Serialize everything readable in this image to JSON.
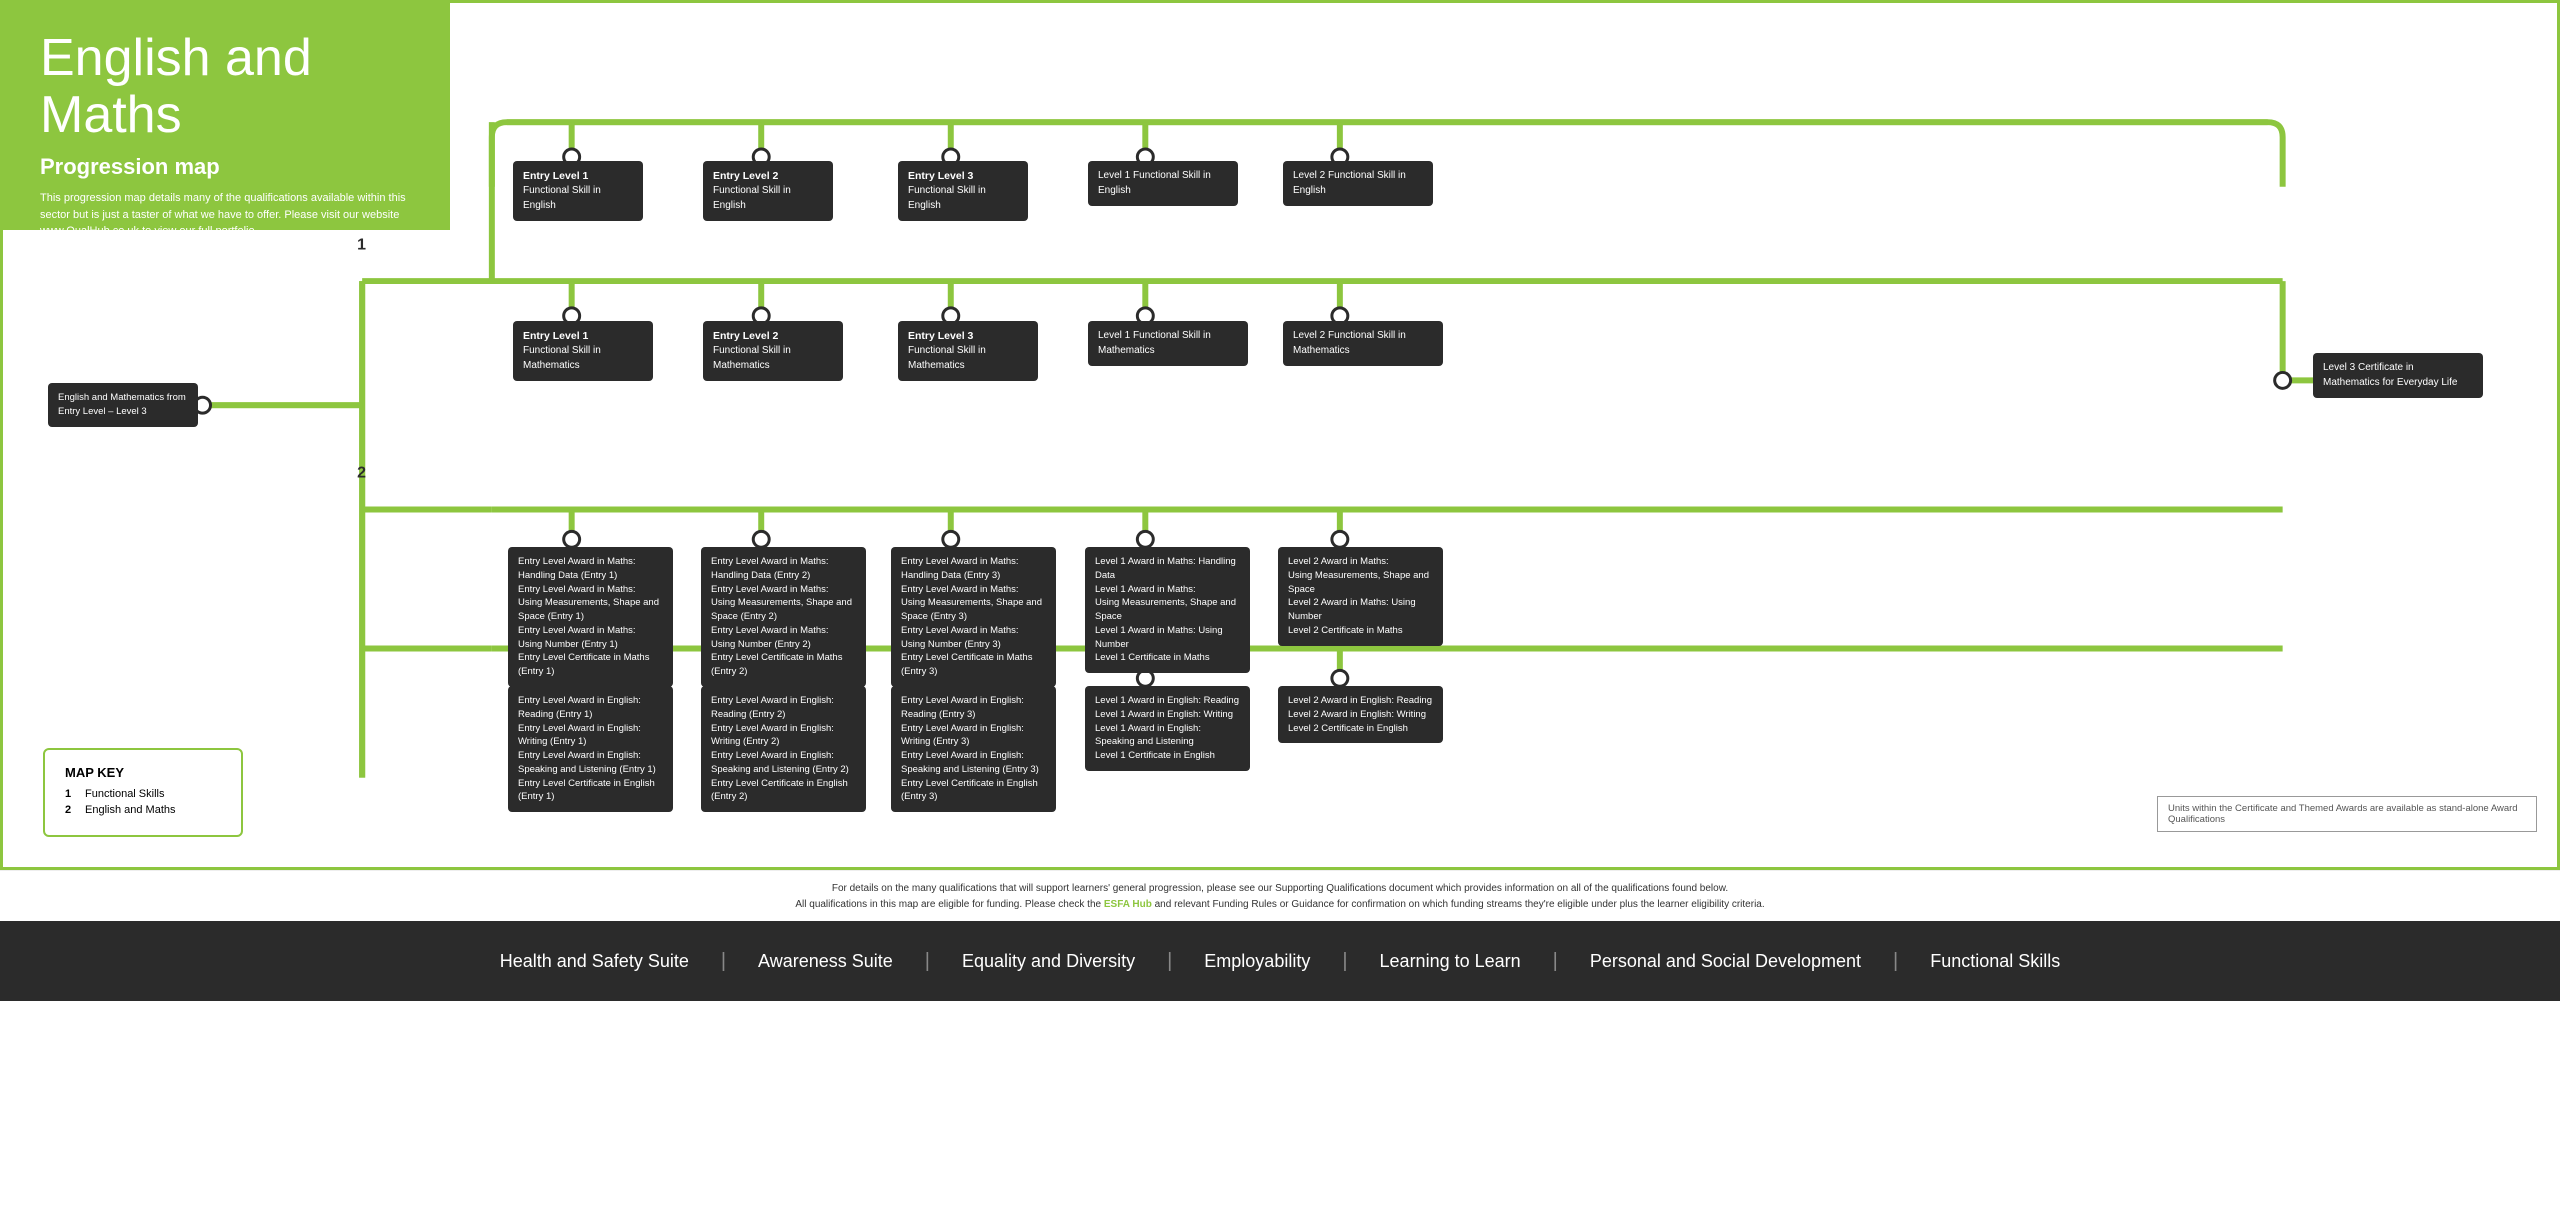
{
  "header": {
    "title": "English and Maths",
    "subtitle": "Progression map",
    "description": "This progression map details many of the qualifications available within this sector but is just a taster of what we have to offer. Please visit our website ",
    "website": "www.QualHub.co.uk",
    "website_suffix": " to view our full portfolio."
  },
  "mapkey": {
    "title": "MAP KEY",
    "items": [
      {
        "num": "1",
        "label": "Functional Skills"
      },
      {
        "num": "2",
        "label": "English and Maths"
      }
    ]
  },
  "tracks": {
    "line1_label": "1",
    "line2_label": "2"
  },
  "qualifications": {
    "start_box": {
      "title": "English and Mathematics from Entry Level – Level 3"
    },
    "row1": [
      {
        "title": "Entry Level 1",
        "sub": "Functional Skill in English"
      },
      {
        "title": "Entry Level 2",
        "sub": "Functional Skill in English"
      },
      {
        "title": "Entry Level 3",
        "sub": "Functional Skill in English"
      },
      {
        "title": "Level 1 Functional Skill in English",
        "sub": ""
      },
      {
        "title": "Level 2 Functional Skill in English",
        "sub": ""
      }
    ],
    "row2": [
      {
        "title": "Entry Level 1",
        "sub": "Functional Skill in Mathematics"
      },
      {
        "title": "Entry Level 2",
        "sub": "Functional Skill in Mathematics"
      },
      {
        "title": "Entry Level 3",
        "sub": "Functional Skill in Mathematics"
      },
      {
        "title": "Level 1 Functional Skill in Mathematics",
        "sub": ""
      },
      {
        "title": "Level 2 Functional Skill in Mathematics",
        "sub": ""
      }
    ],
    "row3": [
      {
        "lines": [
          "Entry Level Award in Maths:",
          "Handling Data (Entry 1)",
          "Entry Level Award in Maths:",
          "Using Measurements, Shape and Space (Entry 1)",
          "Entry Level Award in Maths:",
          "Using Number (Entry 1)",
          "Entry Level Certificate in Maths (Entry 1)"
        ]
      },
      {
        "lines": [
          "Entry Level Award in Maths:",
          "Handling Data (Entry 2)",
          "Entry Level Award in Maths:",
          "Using Measurements, Shape and Space (Entry 2)",
          "Entry Level Award in Maths:",
          "Using Number (Entry 2)",
          "Entry Level Certificate in Maths (Entry 2)"
        ]
      },
      {
        "lines": [
          "Entry Level Award in Maths:",
          "Handling Data (Entry 3)",
          "Entry Level Award in Maths:",
          "Using Measurements, Shape and Space (Entry 3)",
          "Entry Level Award in Maths:",
          "Using Number (Entry 3)",
          "Entry Level Certificate in Maths (Entry 3)"
        ]
      },
      {
        "lines": [
          "Level 1 Award in Maths: Handling Data",
          "Level 1 Award in Maths:",
          "Using Measurements, Shape and Space",
          "Level 1 Award in Maths: Using Number",
          "Level 1 Certificate in Maths"
        ]
      },
      {
        "lines": [
          "Level 2 Award in Maths:",
          "Using Measurements, Shape and Space",
          "Level 2 Award in Maths: Using Number",
          "Level 2 Certificate in Maths"
        ]
      }
    ],
    "row4": [
      {
        "lines": [
          "Entry Level Award in English: Reading (Entry 1)",
          "Entry Level Award in English: Writing (Entry 1)",
          "Entry Level Award in English: Speaking and",
          "Listening (Entry 1)",
          "Entry Level Certificate in English (Entry 1)"
        ]
      },
      {
        "lines": [
          "Entry Level Award in English: Reading (Entry 2)",
          "Entry Level Award in English: Writing (Entry 2)",
          "Entry Level Award in English: Speaking and",
          "Listening (Entry 2)",
          "Entry Level Certificate in English (Entry 2)"
        ]
      },
      {
        "lines": [
          "Entry Level Award in English: Reading (Entry 3)",
          "Entry Level Award in English: Writing (Entry 3)",
          "Entry Level Award in English: Speaking and",
          "Listening (Entry 3)",
          "Entry Level Certificate in English (Entry 3)"
        ]
      },
      {
        "lines": [
          "Level 1 Award in English: Reading",
          "Level 1 Award in English: Writing",
          "Level 1 Award in English: Speaking and Listening",
          "Level 1 Certificate in English"
        ]
      },
      {
        "lines": [
          "Level 2 Award in English: Reading",
          "Level 2 Award in English: Writing",
          "Level 2 Certificate in English"
        ]
      }
    ],
    "extra_box": {
      "title": "Level 3 Certificate in Mathematics for Everyday Life"
    }
  },
  "units_note": "Units within the Certificate and Themed Awards are available as stand-alone Award Qualifications",
  "footer": {
    "note1": "For details on the many qualifications that will support learners'  general progression, please see our Supporting Qualifications document which provides information on all of the qualifications found below.",
    "note2": "All qualifications in this map are eligible for funding. Please check the ",
    "esfa": "ESFA Hub",
    "note3": " and relevant Funding Rules or Guidance for confirmation on which funding streams they're eligible under plus the learner eligibility criteria."
  },
  "nav": {
    "items": [
      "Health and Safety Suite",
      "Awareness Suite",
      "Equality and Diversity",
      "Employability",
      "Learning to Learn",
      "Personal and Social Development",
      "Functional Skills"
    ]
  }
}
